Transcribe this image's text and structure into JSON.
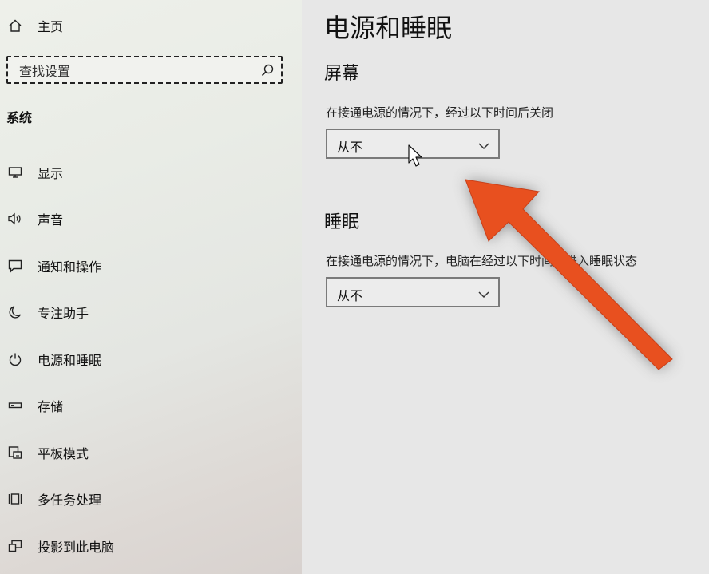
{
  "sidebar": {
    "home_label": "主页",
    "search_placeholder": "查找设置",
    "section_label": "系统",
    "items": [
      {
        "label": "显示",
        "icon": "monitor-icon"
      },
      {
        "label": "声音",
        "icon": "speaker-icon"
      },
      {
        "label": "通知和操作",
        "icon": "notification-icon"
      },
      {
        "label": "专注助手",
        "icon": "moon-icon"
      },
      {
        "label": "电源和睡眠",
        "icon": "power-icon"
      },
      {
        "label": "存储",
        "icon": "storage-icon"
      },
      {
        "label": "平板模式",
        "icon": "tablet-mode-icon"
      },
      {
        "label": "多任务处理",
        "icon": "multitasking-icon"
      },
      {
        "label": "投影到此电脑",
        "icon": "projecting-icon"
      }
    ]
  },
  "main": {
    "title": "电源和睡眠",
    "screen": {
      "heading": "屏幕",
      "description": "在接通电源的情况下，经过以下时间后关闭",
      "value": "从不"
    },
    "sleep": {
      "heading": "睡眠",
      "description": "在接通电源的情况下，电脑在经过以下时间后进入睡眠状态",
      "value": "从不"
    }
  },
  "annotation": {
    "arrow_color": "#e8501f",
    "icon": "red-arrow-annotation"
  }
}
